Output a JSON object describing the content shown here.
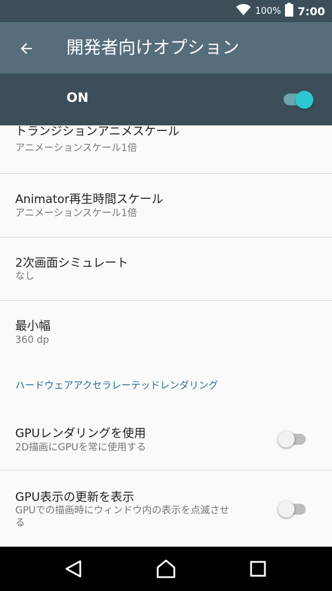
{
  "status_bar": {
    "battery_percent": "100%",
    "time": "7:00",
    "icons": [
      "wifi-icon",
      "battery-icon"
    ]
  },
  "app_bar": {
    "title": "開発者向けオプション",
    "back_icon": "arrow-left-icon"
  },
  "master_switch": {
    "label": "ON",
    "checked": true
  },
  "settings": {
    "transition_scale": {
      "title": "トランジションアニメスケール",
      "summary": "アニメーションスケール1倍"
    },
    "animator_scale": {
      "title": "Animator再生時間スケール",
      "summary": "アニメーションスケール1倍"
    },
    "secondary_display": {
      "title": "2次画面シミュレート",
      "summary": "なし"
    },
    "smallest_width": {
      "title": "最小幅",
      "summary": "360 dp"
    },
    "section_hw": "ハードウェアアクセラレーテッドレンダリング",
    "force_gpu": {
      "title": "GPUレンダリングを使用",
      "summary": "2D描画にGPUを常に使用する",
      "checked": false
    },
    "show_gpu_updates": {
      "title": "GPU表示の更新を表示",
      "summary_line1": "GPUでの描画時にウィンドウ内の表示を点滅させ",
      "summary_line2": "る",
      "checked": false
    }
  },
  "nav_bar": {
    "buttons": [
      "back-icon",
      "home-icon",
      "recents-icon"
    ]
  },
  "colors": {
    "status_bar": "#3b4e5a",
    "app_bar": "#566d7b",
    "accent": "#2fc6d3",
    "section_header": "#2a6a9d"
  }
}
